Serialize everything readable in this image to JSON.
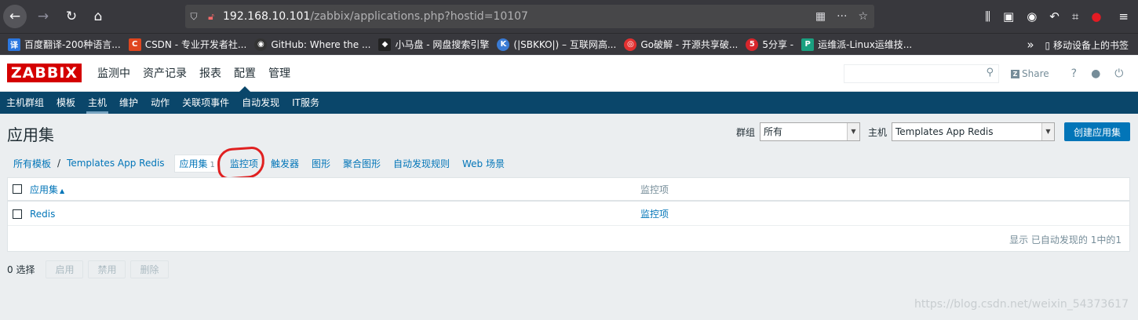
{
  "browser": {
    "url_host": "192.168.10.101",
    "url_path": "/zabbix/applications.php?hostid=10107",
    "icons": [
      "back-icon",
      "forward-icon",
      "reload-icon",
      "home-icon",
      "shield-icon",
      "insecure-lock-icon",
      "qr-icon",
      "more-icon",
      "star-icon",
      "library-icon",
      "sidebar-icon",
      "account-icon",
      "undo-icon",
      "screenshot-icon",
      "extension-icon",
      "menu-icon"
    ]
  },
  "bookmarks": {
    "items": [
      {
        "fav": "译",
        "label": "百度翻译-200种语言...",
        "color": "#2b77e0"
      },
      {
        "fav": "C",
        "label": "CSDN - 专业开发者社...",
        "color": "#e0461f"
      },
      {
        "fav": "◉",
        "label": "GitHub: Where the ...",
        "color": "#333333"
      },
      {
        "fav": "◆",
        "label": "小马盘 - 网盘搜索引擎",
        "color": "#222222"
      },
      {
        "fav": "K",
        "label": "(|SBKKO|) – 互联网高...",
        "color": "#3a7bd5"
      },
      {
        "fav": "◎",
        "label": "Go破解 - 开源共享破...",
        "color": "#e33030"
      },
      {
        "fav": "5",
        "label": "5分享 -",
        "color": "#d8262c"
      },
      {
        "fav": "P",
        "label": "运维派-Linux运维技...",
        "color": "#1aa080"
      }
    ],
    "overflow": "»",
    "mobile": "移动设备上的书签"
  },
  "zabbix": {
    "logo": "ZABBIX",
    "top_menu": [
      "监测中",
      "资产记录",
      "报表",
      "配置",
      "管理"
    ],
    "top_menu_active": 3,
    "share_label": "Share",
    "help": "?",
    "sub_nav": [
      "主机群组",
      "模板",
      "主机",
      "维护",
      "动作",
      "关联项事件",
      "自动发现",
      "IT服务"
    ],
    "sub_nav_active": 2
  },
  "page": {
    "title": "应用集",
    "group_label": "群组",
    "group_value": "所有",
    "host_label": "主机",
    "host_value": "Templates App Redis",
    "create_button": "创建应用集"
  },
  "tabs": {
    "all_templates": "所有模板",
    "separator": "/",
    "template": "Templates App Redis",
    "applications": "应用集",
    "applications_count": "1",
    "items": "监控项",
    "triggers": "触发器",
    "graphs": "图形",
    "screens": "聚合图形",
    "discovery": "自动发现规则",
    "web": "Web 场景"
  },
  "table": {
    "header_app": "应用集",
    "sort_arrow": "▲",
    "header_items": "监控项",
    "rows": [
      {
        "name": "Redis",
        "items": "监控项"
      }
    ],
    "paging": "显示 已自动发现的 1中的1"
  },
  "footer": {
    "selected": "0 选择",
    "enable": "启用",
    "disable": "禁用",
    "delete": "删除"
  },
  "watermark": "https://blog.csdn.net/weixin_54373617"
}
